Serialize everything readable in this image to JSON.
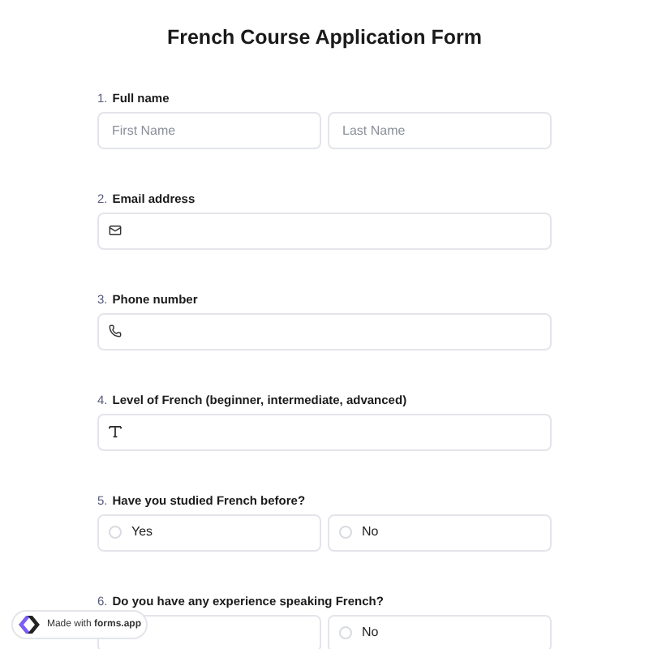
{
  "title": "French Course Application Form",
  "questions": [
    {
      "number": "1.",
      "label": "Full name",
      "kind": "name",
      "fields": [
        {
          "placeholder": "First Name"
        },
        {
          "placeholder": "Last Name"
        }
      ]
    },
    {
      "number": "2.",
      "label": "Email address",
      "kind": "email"
    },
    {
      "number": "3.",
      "label": "Phone number",
      "kind": "phone"
    },
    {
      "number": "4.",
      "label": "Level of French (beginner, intermediate, advanced)",
      "kind": "text"
    },
    {
      "number": "5.",
      "label": "Have you studied French before?",
      "kind": "choice",
      "options": [
        {
          "label": "Yes",
          "selected": false
        },
        {
          "label": "No",
          "selected": false
        }
      ]
    },
    {
      "number": "6.",
      "label": "Do you have any experience speaking French?",
      "kind": "choice",
      "options": [
        {
          "label": "No",
          "selected": false
        }
      ]
    }
  ],
  "badge": "Made with **forms.app**"
}
